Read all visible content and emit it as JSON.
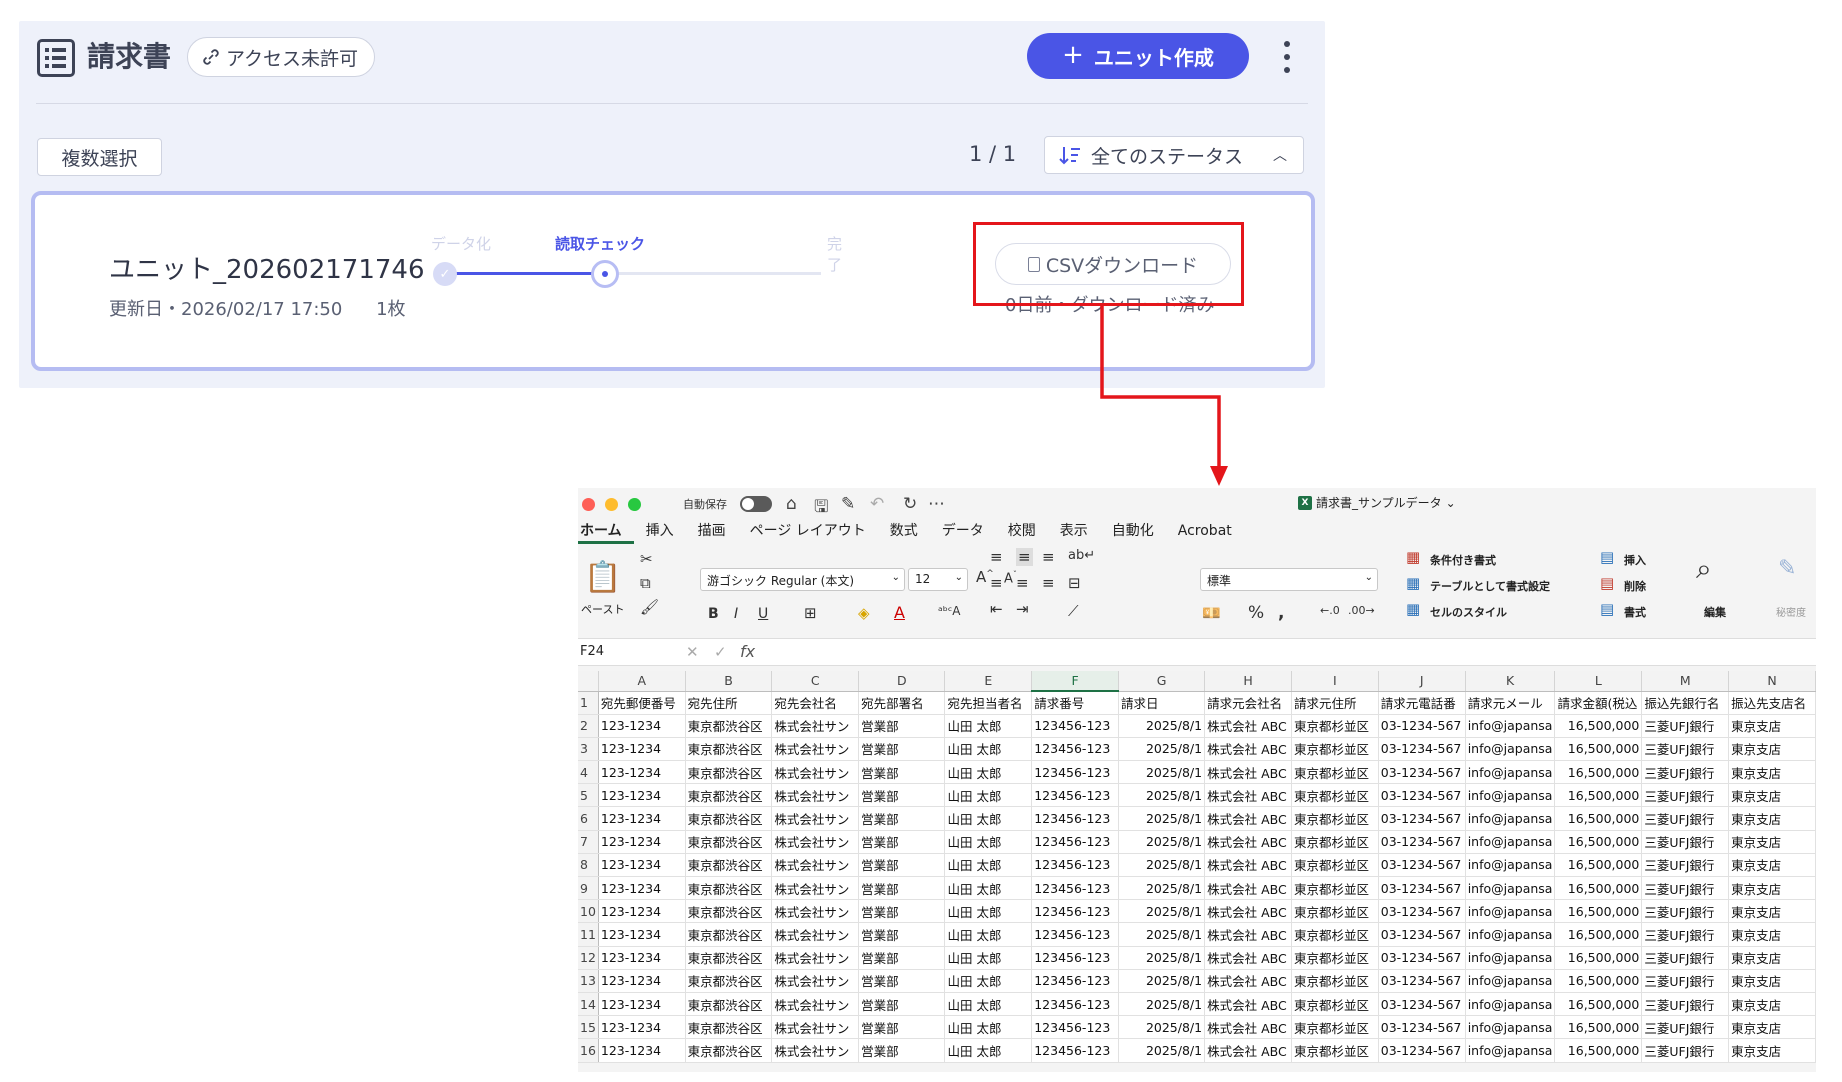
{
  "app": {
    "title": "請求書",
    "access_label": "アクセス未許可",
    "create_button": "ユニット作成",
    "multi_select": "複数選択",
    "pager": "1 / 1",
    "status_filter": "全てのステータス",
    "unit": {
      "name": "ユニット_202602171746",
      "updated": "更新日・2026/02/17 17:50",
      "pages": "1枚",
      "steps": {
        "done": "データ化",
        "current": "読取チェック",
        "later": "完了"
      },
      "csv_button": "CSVダウンロード",
      "download_status": "0日前・ダウンロード済み"
    }
  },
  "excel": {
    "autosave_label": "自動保存",
    "doc_title": "請求書_サンプルデータ",
    "tabs": [
      "ホーム",
      "挿入",
      "描画",
      "ページ レイアウト",
      "数式",
      "データ",
      "校閲",
      "表示",
      "自動化",
      "Acrobat"
    ],
    "ribbon": {
      "paste": "ペースト",
      "font": "游ゴシック Regular (本文)",
      "font_size": "12",
      "number_format": "標準",
      "conditional": "条件付き書式",
      "table_format": "テーブルとして書式設定",
      "cell_style": "セルのスタイル",
      "insert": "挿入",
      "delete": "削除",
      "format": "書式",
      "edit": "編集",
      "sensitivity": "秘密度"
    },
    "name_box": "F24",
    "fx_label": "fx",
    "columns": [
      "A",
      "B",
      "C",
      "D",
      "E",
      "F",
      "G",
      "H",
      "I",
      "J",
      "K",
      "L",
      "M",
      "N"
    ],
    "selected_column": "F",
    "header_row": [
      "宛先郵便番号",
      "宛先住所",
      "宛先会社名",
      "宛先部署名",
      "宛先担当者名",
      "請求番号",
      "請求日",
      "請求元会社名",
      "請求元住所",
      "請求元電話番",
      "請求元メール",
      "請求金額(税込",
      "振込先銀行名",
      "振込先支店名"
    ],
    "data_row": [
      "123-1234",
      "東京都渋谷区",
      "株式会社サン",
      "営業部",
      "山田 太郎",
      "123456-123",
      "2025/8/1",
      "株式会社 ABC",
      "東京都杉並区",
      "03-1234-567",
      "info@japansa",
      "16,500,000",
      "三菱UFJ銀行",
      "東京支店"
    ],
    "row_numbers": [
      "1",
      "2",
      "3",
      "4",
      "5",
      "6",
      "7",
      "8",
      "9",
      "10",
      "11",
      "12",
      "13",
      "14",
      "15",
      "16"
    ]
  }
}
